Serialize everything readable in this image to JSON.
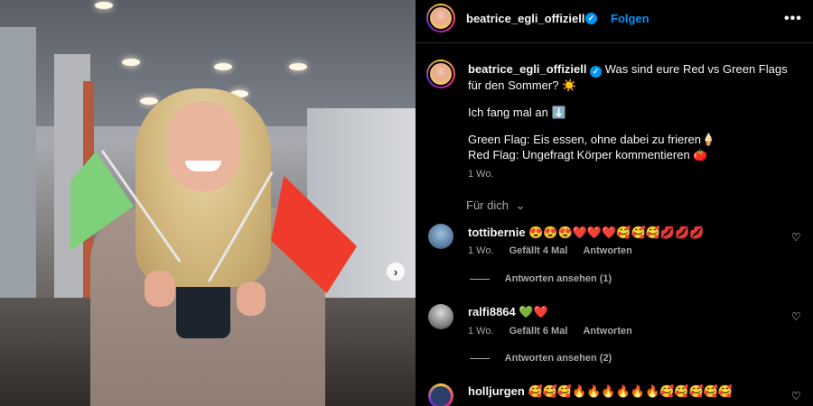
{
  "post": {
    "username": "beatrice_egli_offiziell",
    "follow_label": "Folgen",
    "more_label": "•••",
    "verified_glyph": "✓",
    "caption_line1": "Was sind eure Red vs Green Flags für den Sommer? ☀️",
    "caption_line2": "Ich fang mal an ⬇️",
    "caption_line3": "Green Flag: Eis essen, ohne dabei zu frieren🍦",
    "caption_line4": "Red Flag: Ungefragt Körper kommentieren 🍅",
    "caption_time": "1 Wo.",
    "filter_label": "Für dich",
    "carousel_next_glyph": "›"
  },
  "comments": [
    {
      "username": "tottibernie",
      "text": "😍😍😍❤️❤️❤️🥰🥰🥰💋💋💋",
      "time": "1 Wo.",
      "likes": "Gefällt 4 Mal",
      "reply": "Antworten",
      "view_replies": "Antworten ansehen (1)"
    },
    {
      "username": "ralfi8864",
      "text": "💚❤️",
      "time": "1 Wo.",
      "likes": "Gefällt 6 Mal",
      "reply": "Antworten",
      "view_replies": "Antworten ansehen (2)"
    },
    {
      "username": "holljurgen",
      "text": "🥰🥰🥰🔥🔥🔥🔥🔥🔥🥰🥰🥰🥰🥰"
    }
  ],
  "icons": {
    "heart": "♡",
    "chevron_down": "⌄"
  },
  "colors": {
    "accent": "#0095f6",
    "background": "#000000",
    "secondary_text": "#a8a8a8"
  }
}
